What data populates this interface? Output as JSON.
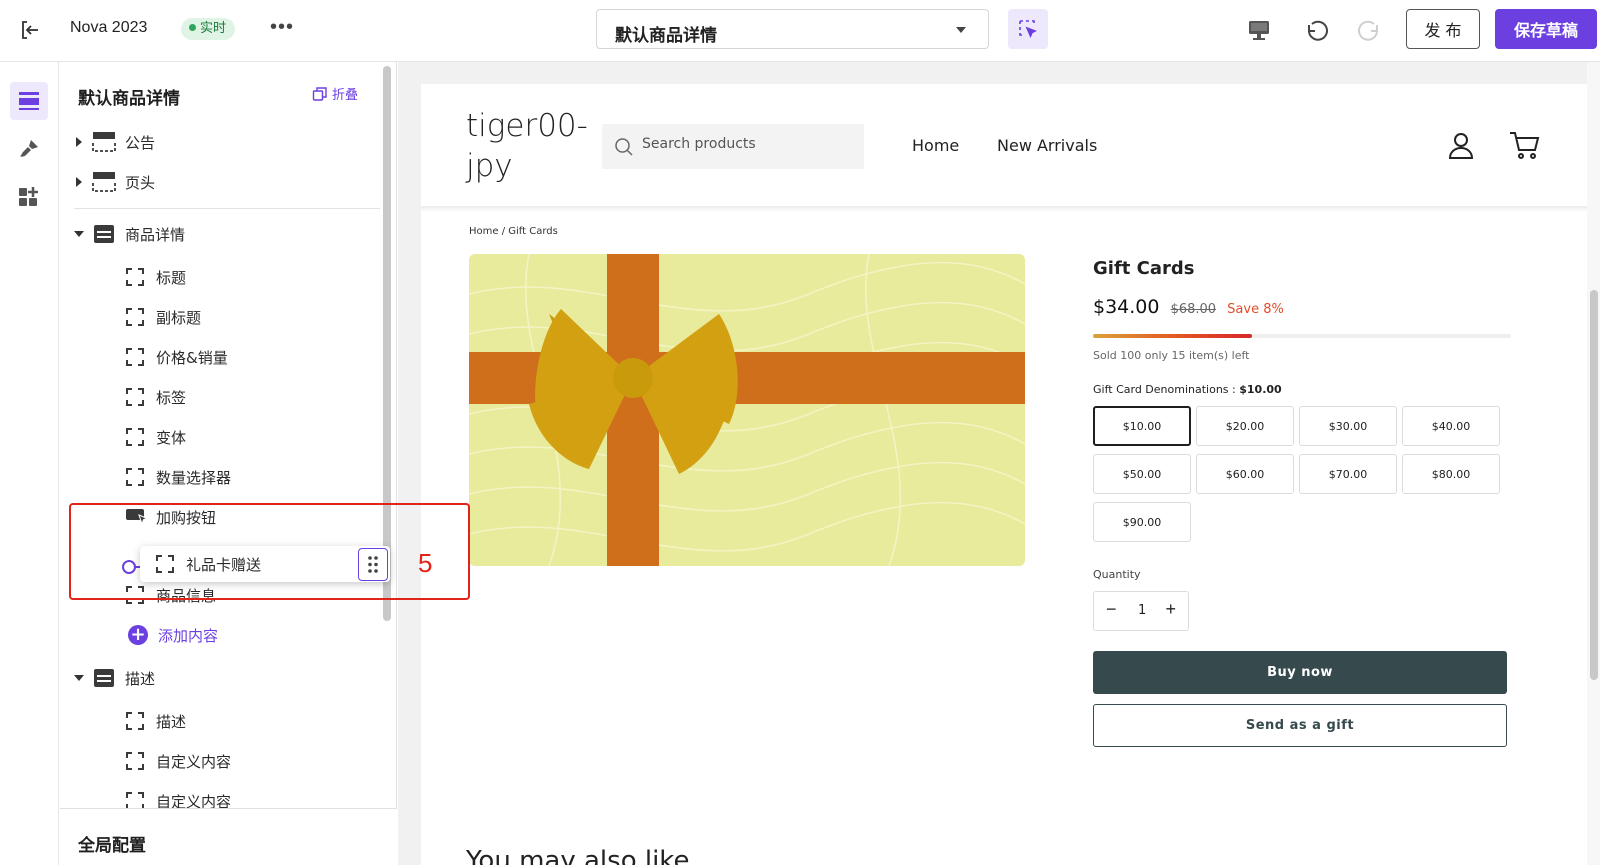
{
  "topbar": {
    "app_name": "Nova 2023",
    "live_badge": "实时",
    "more_label": "•••",
    "page_select_value": "默认商品详情",
    "publish_label": "发 布",
    "save_draft_label": "保存草稿",
    "accent_color": "#6b3fe0"
  },
  "panel": {
    "title": "默认商品详情",
    "collapse_label": "折叠",
    "sections": [
      {
        "label": "公告",
        "expanded": false
      },
      {
        "label": "页头",
        "expanded": false
      },
      {
        "label": "商品详情",
        "expanded": true,
        "children": [
          "标题",
          "副标题",
          "价格&销量",
          "标签",
          "变体",
          "数量选择器",
          "加购按钮",
          "商品信息"
        ],
        "add_label": "添加内容"
      },
      {
        "label": "描述",
        "expanded": true,
        "children": [
          "描述",
          "自定义内容",
          "自定义内容"
        ]
      }
    ],
    "dragging_item": "礼品卡赠送",
    "bottom_section": "全局配置"
  },
  "annotation": {
    "step_number": "5",
    "color": "#e2231a"
  },
  "store": {
    "logo": "tiger00-jpy",
    "search_placeholder": "Search products",
    "nav": [
      "Home",
      "New Arrivals"
    ],
    "breadcrumb": "Home / Gift Cards",
    "product_title": "Gift Cards",
    "price_now": "$34.00",
    "price_old": "$68.00",
    "price_save": "Save 8%",
    "stock_fraction": 0.38,
    "stock_text": "Sold 100 only 15 item(s) left",
    "denom_label": "Gift Card Denominations : ",
    "denom_selected": "$10.00",
    "denominations": [
      "$10.00",
      "$20.00",
      "$30.00",
      "$40.00",
      "$50.00",
      "$60.00",
      "$70.00",
      "$80.00",
      "$90.00"
    ],
    "quantity_label": "Quantity",
    "quantity_value": "1",
    "buy_now": "Buy now",
    "send_gift": "Send as a gift",
    "also_like": "You may also like"
  }
}
